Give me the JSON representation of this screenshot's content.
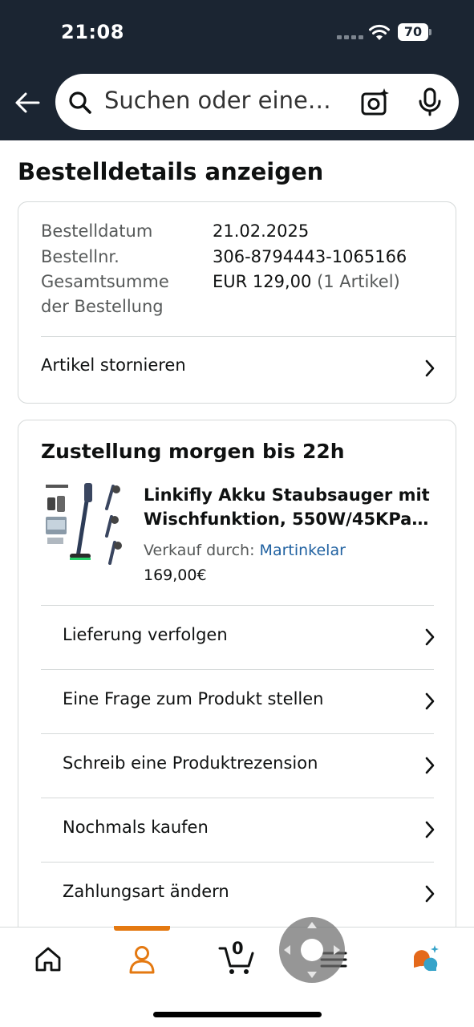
{
  "status_bar": {
    "time": "21:08",
    "battery": "70"
  },
  "search": {
    "placeholder": "Suchen oder eine…"
  },
  "page": {
    "title": "Bestelldetails anzeigen"
  },
  "order_summary": {
    "date_label": "Bestelldatum",
    "date_value": "21.02.2025",
    "number_label": "Bestellnr.",
    "number_value": "306-8794443-1065166",
    "total_label_line1": "Gesamtsumme",
    "total_label_line2": "der Bestellung",
    "total_value": "EUR 129,00",
    "total_items": "(1 Artikel)",
    "cancel_label": "Artikel stornieren"
  },
  "delivery": {
    "heading": "Zustellung morgen bis 22h",
    "product_title_line1": "Linkifly Akku Staubsauger mit",
    "product_title_line2": "Wischfunktion, 550W/45KPa…",
    "seller_prefix": "Verkauf durch: ",
    "seller_name": "Martinkelar",
    "price": "169,00€",
    "actions": [
      {
        "label": "Lieferung verfolgen"
      },
      {
        "label": "Eine Frage zum Produkt stellen"
      },
      {
        "label": "Schreib eine Produktrezension"
      },
      {
        "label": "Nochmals kaufen"
      },
      {
        "label": "Zahlungsart ändern"
      }
    ]
  },
  "bottom_nav": {
    "cart_count": "0",
    "active_tab": "account",
    "accent_color": "#e47911",
    "items": [
      {
        "icon": "home-icon"
      },
      {
        "icon": "account-icon"
      },
      {
        "icon": "cart-icon"
      },
      {
        "icon": "menu-icon"
      },
      {
        "icon": "rufus-assistant-icon"
      }
    ]
  },
  "colors": {
    "header_bg": "#1b2532",
    "link": "#2162a1",
    "accent": "#e47911"
  }
}
